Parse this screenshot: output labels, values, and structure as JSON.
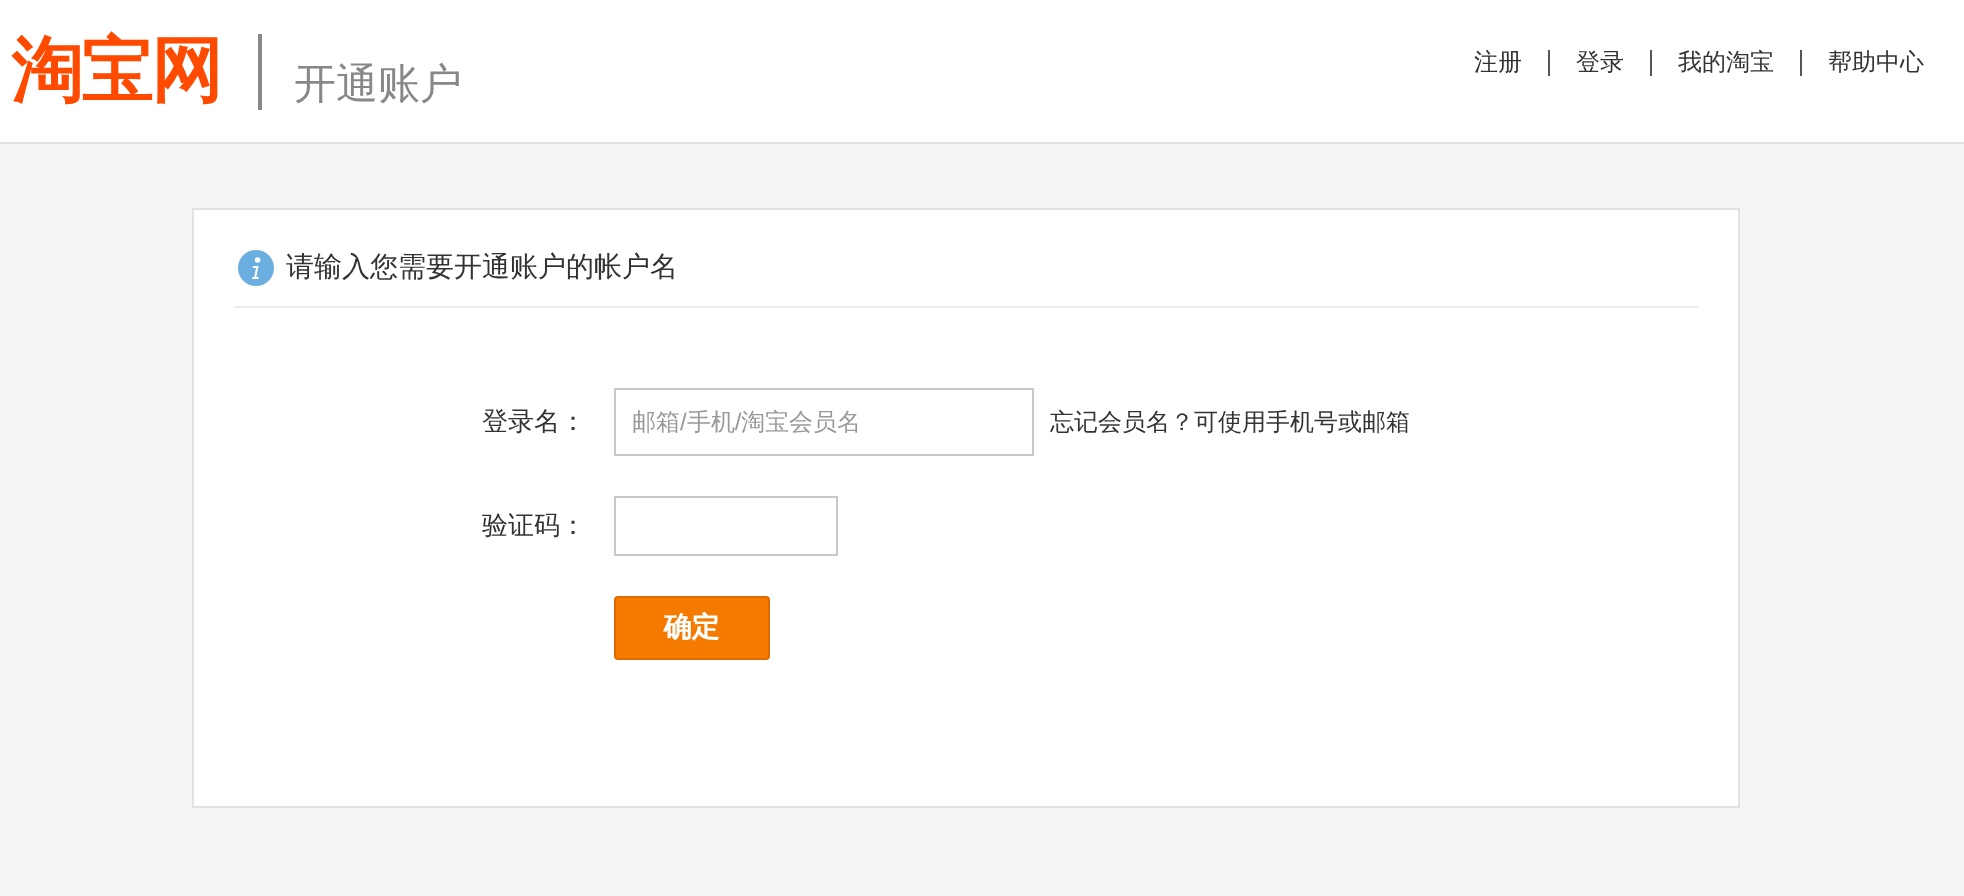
{
  "header": {
    "logo": "淘宝网",
    "subtitle": "开通账户",
    "nav": [
      {
        "label": "注册"
      },
      {
        "label": "登录"
      },
      {
        "label": "我的淘宝"
      },
      {
        "label": "帮助中心"
      }
    ]
  },
  "panel": {
    "title": "请输入您需要开通账户的帐户名",
    "fields": [
      {
        "kind": "wide",
        "label": "登录名：",
        "placeholder": "邮箱/手机/淘宝会员名",
        "hint": "忘记会员名？可使用手机号或邮箱"
      },
      {
        "kind": "narrow",
        "label": "验证码："
      }
    ],
    "submit": "确定"
  }
}
